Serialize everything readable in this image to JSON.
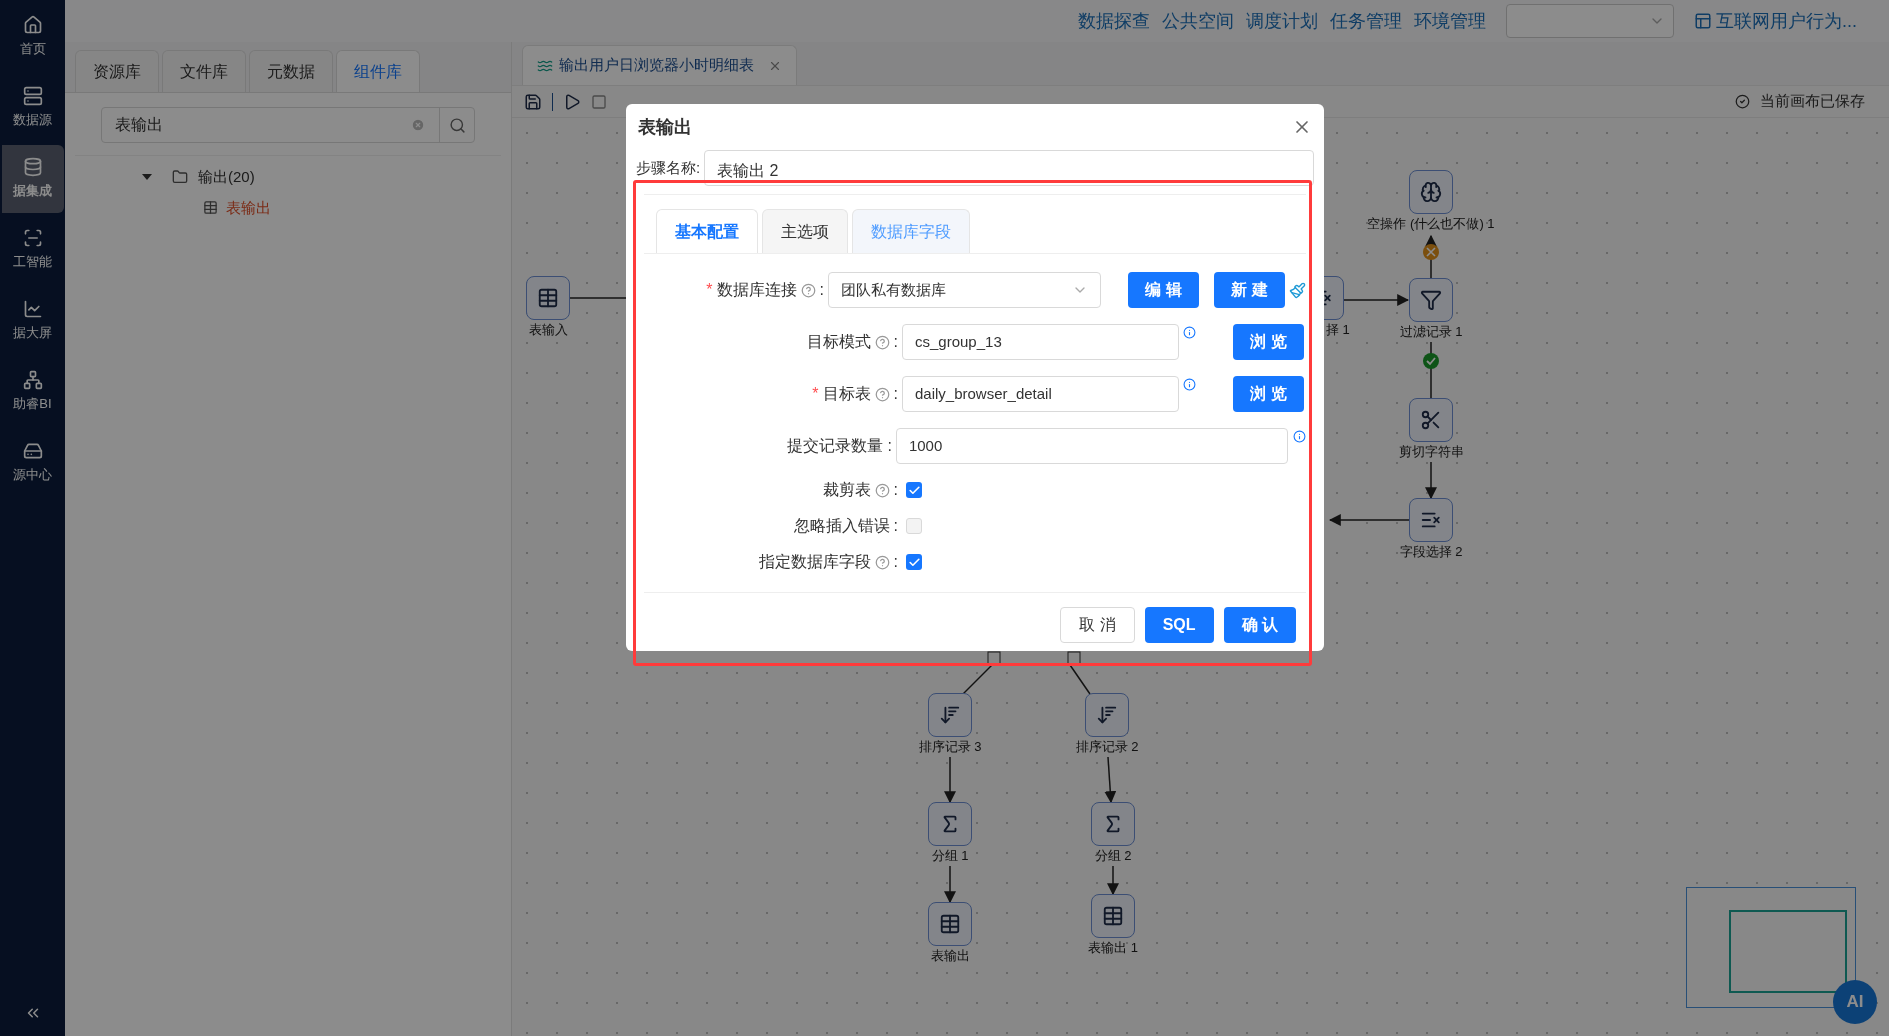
{
  "sidebar": {
    "items": [
      {
        "label": "首页",
        "selected": false
      },
      {
        "label": "数据源",
        "selected": false
      },
      {
        "label": "据集成",
        "selected": true
      },
      {
        "label": "工智能",
        "selected": false
      },
      {
        "label": "据大屏",
        "selected": false
      },
      {
        "label": "助睿BI",
        "selected": false
      },
      {
        "label": "源中心",
        "selected": false
      }
    ]
  },
  "top_nav": {
    "links": [
      "数据探查",
      "公共空间",
      "调度计划",
      "任务管理",
      "环境管理"
    ],
    "project": "互联网用户行为..."
  },
  "left_panel": {
    "tabs": [
      {
        "label": "资源库",
        "selected": false
      },
      {
        "label": "文件库",
        "selected": false
      },
      {
        "label": "元数据",
        "selected": false
      },
      {
        "label": "组件库",
        "selected": true
      }
    ],
    "search": {
      "value": "表输出"
    },
    "tree": [
      {
        "label": "输出(20)",
        "expanded": true,
        "children": [
          {
            "label": "表输出",
            "selected": true
          }
        ]
      }
    ]
  },
  "editor": {
    "tabs": [
      {
        "label": "输出用户日浏览器小时明细表"
      }
    ],
    "save_status": "当前画布已保存",
    "ai_button": "AI"
  },
  "canvas": {
    "nodes": [
      {
        "label": "表输入",
        "kind": "table-in"
      },
      {
        "label": "择 1",
        "kind": "field-select"
      },
      {
        "label": "空操作 (什么也不做) 1",
        "kind": "brain"
      },
      {
        "label": "过滤记录 1",
        "kind": "filter"
      },
      {
        "label": "剪切字符串",
        "kind": "scissors"
      },
      {
        "label": "字段选择 2",
        "kind": "field-select"
      },
      {
        "label": "排序记录 3",
        "kind": "sort"
      },
      {
        "label": "排序记录 2",
        "kind": "sort"
      },
      {
        "label": "分组 1",
        "kind": "group"
      },
      {
        "label": "分组 2",
        "kind": "group"
      },
      {
        "label": "表输出",
        "kind": "table-out"
      },
      {
        "label": "表输出 1",
        "kind": "table-out"
      }
    ]
  },
  "dialog": {
    "title": "表输出",
    "step_name_label": "步骤名称:",
    "step_name": "表输出 2",
    "tabs": [
      {
        "label": "基本配置",
        "selected": true,
        "hovered": false
      },
      {
        "label": "主选项",
        "selected": false,
        "hovered": false
      },
      {
        "label": "数据库字段",
        "selected": false,
        "hovered": true
      }
    ],
    "fields": [
      {
        "kind": "select",
        "required_mark": "*",
        "label": "数据库连接",
        "help": true,
        "colon": ":",
        "value": "团队私有数据库",
        "buttons": [
          "编 辑",
          "新 建"
        ]
      },
      {
        "kind": "input",
        "label": "目标模式",
        "help": true,
        "colon": ":",
        "value": "cs_group_13",
        "info": true,
        "buttons": [
          "浏 览"
        ]
      },
      {
        "kind": "input",
        "required_mark": "*",
        "label": "目标表",
        "help": true,
        "colon": ":",
        "value": "daily_browser_detail",
        "info": true,
        "buttons": [
          "浏 览"
        ]
      },
      {
        "kind": "wide-input",
        "label": "提交记录数量",
        "help": false,
        "colon": ":",
        "value": "1000",
        "info": true
      },
      {
        "kind": "checkbox",
        "label": "裁剪表",
        "help": true,
        "colon": ":",
        "checked": true
      },
      {
        "kind": "checkbox",
        "label": "忽略插入错误",
        "help": false,
        "colon": ":",
        "checked": false
      },
      {
        "kind": "checkbox",
        "label": "指定数据库字段",
        "help": true,
        "colon": ":",
        "checked": true
      }
    ],
    "buttons": [
      {
        "label": "取 消",
        "primary": false
      },
      {
        "label": "SQL",
        "primary": true
      },
      {
        "label": "确 认",
        "primary": true
      }
    ]
  }
}
